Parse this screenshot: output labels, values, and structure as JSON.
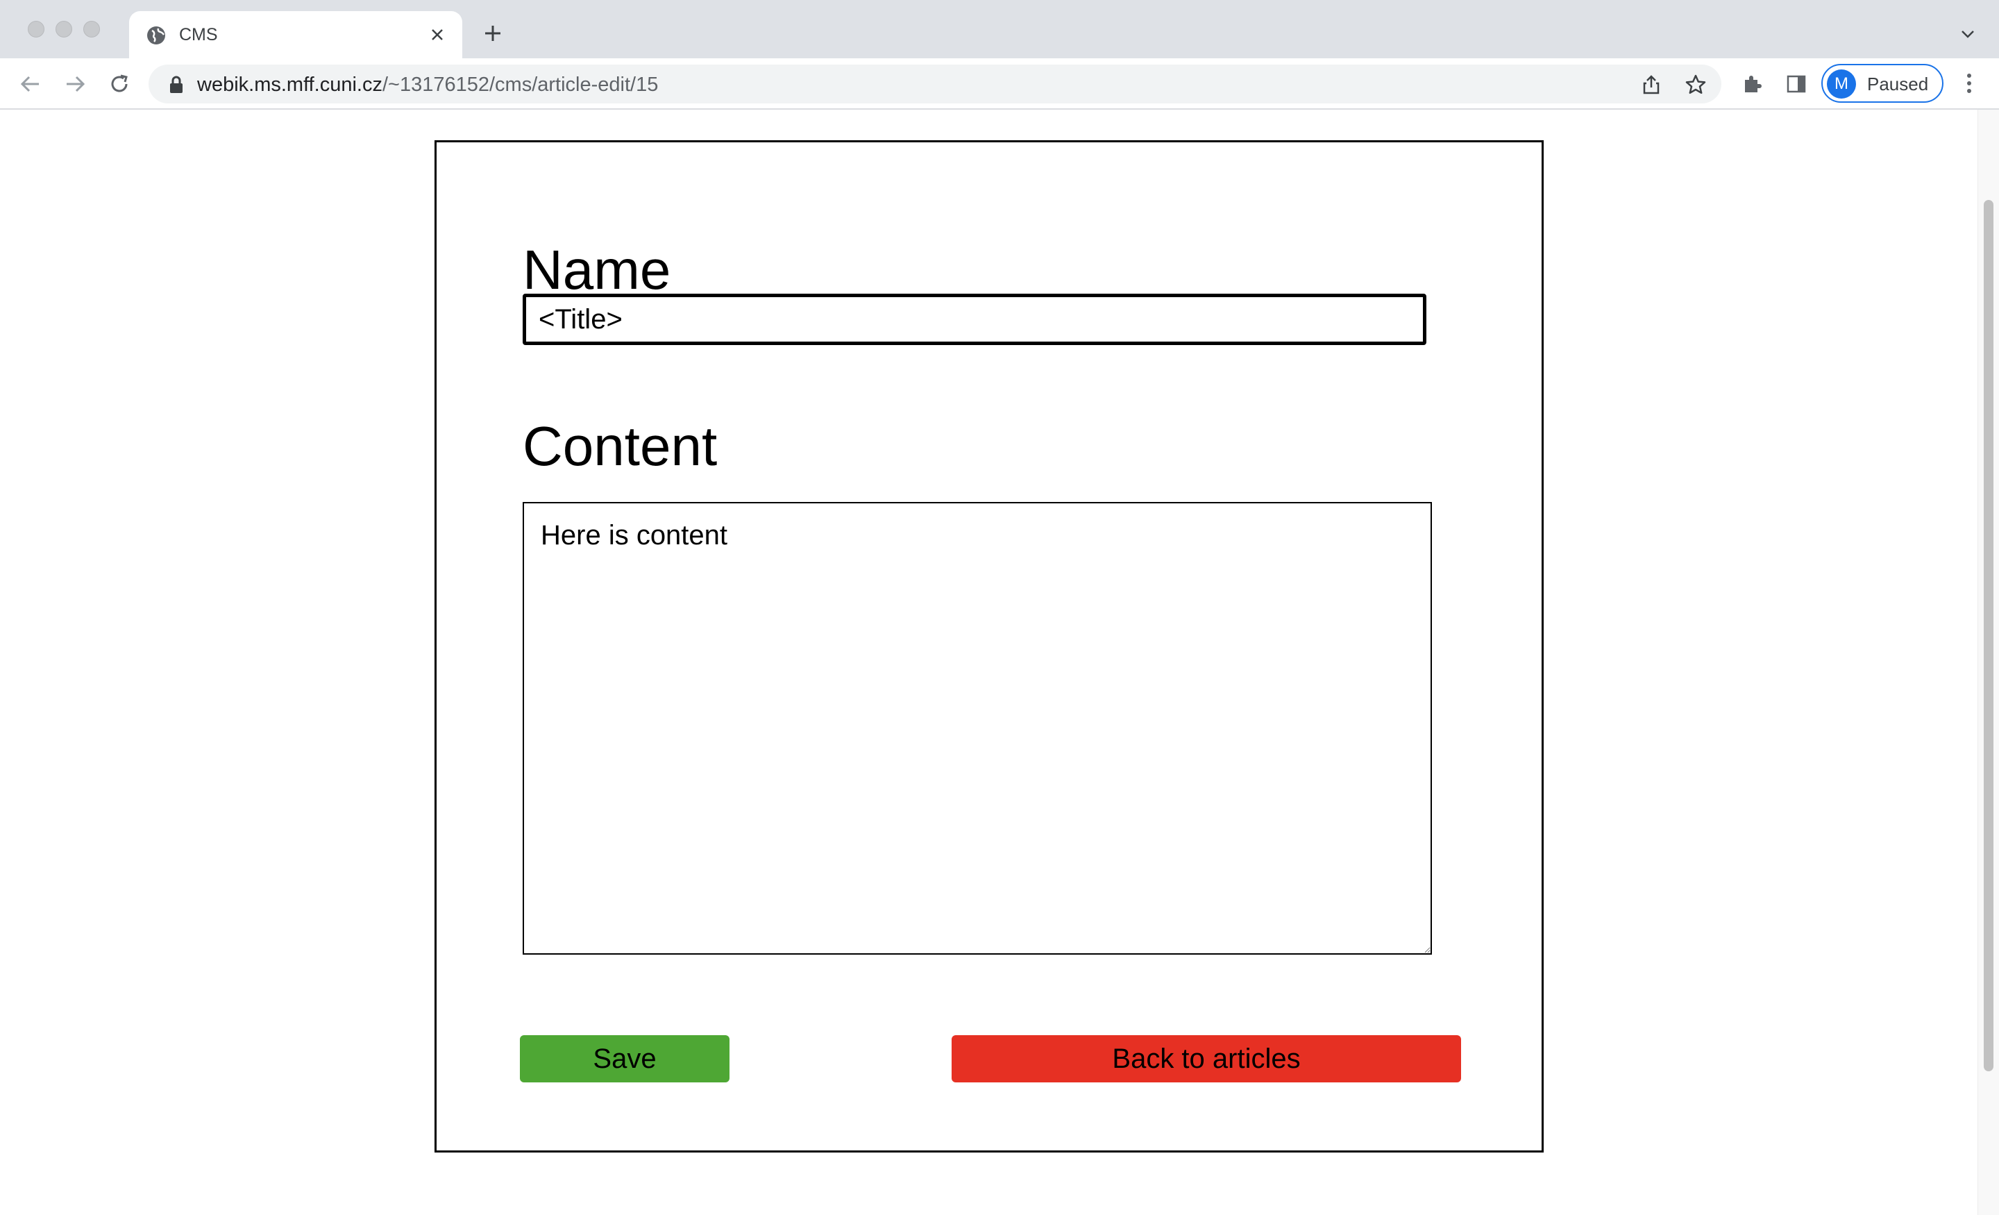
{
  "browser": {
    "tab": {
      "title": "CMS"
    },
    "address_bar": {
      "host": "webik.ms.mff.cuni.cz",
      "path": "/~13176152/cms/article-edit/15"
    },
    "profile": {
      "initial": "M",
      "label": "Paused"
    }
  },
  "form": {
    "name_heading": "Name",
    "name_value": "<Title>",
    "content_heading": "Content",
    "content_value": "Here is content",
    "save_label": "Save",
    "back_label": "Back to articles"
  },
  "colors": {
    "save_button": "#4ea734",
    "back_button": "#e63023",
    "profile_accent": "#1a73e8"
  }
}
